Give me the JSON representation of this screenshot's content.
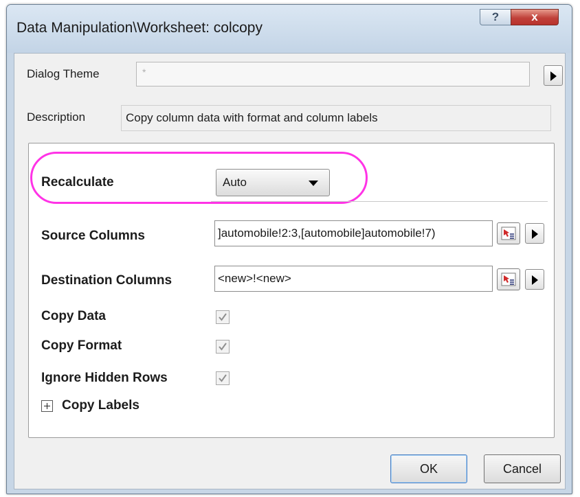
{
  "window": {
    "title": "Data Manipulation\\Worksheet: colcopy",
    "help_label": "?",
    "close_label": "x"
  },
  "theme": {
    "label": "Dialog Theme",
    "value": "*"
  },
  "description": {
    "label": "Description",
    "text": "Copy column data with format and column labels"
  },
  "options": {
    "recalculate": {
      "label": "Recalculate",
      "value": "Auto"
    },
    "source_columns": {
      "label": "Source Columns",
      "value": "]automobile!2:3,[automobile]automobile!7)"
    },
    "destination_columns": {
      "label": "Destination Columns",
      "value": "<new>!<new>"
    },
    "copy_data": {
      "label": "Copy Data",
      "checked": true
    },
    "copy_format": {
      "label": "Copy Format",
      "checked": true
    },
    "ignore_hidden_rows": {
      "label": "Ignore Hidden Rows",
      "checked": true
    },
    "copy_labels": {
      "label": "Copy Labels",
      "expanded": false
    }
  },
  "buttons": {
    "ok": "OK",
    "cancel": "Cancel"
  },
  "colors": {
    "highlight": "#ff33e6",
    "close_button": "#c0413a"
  }
}
